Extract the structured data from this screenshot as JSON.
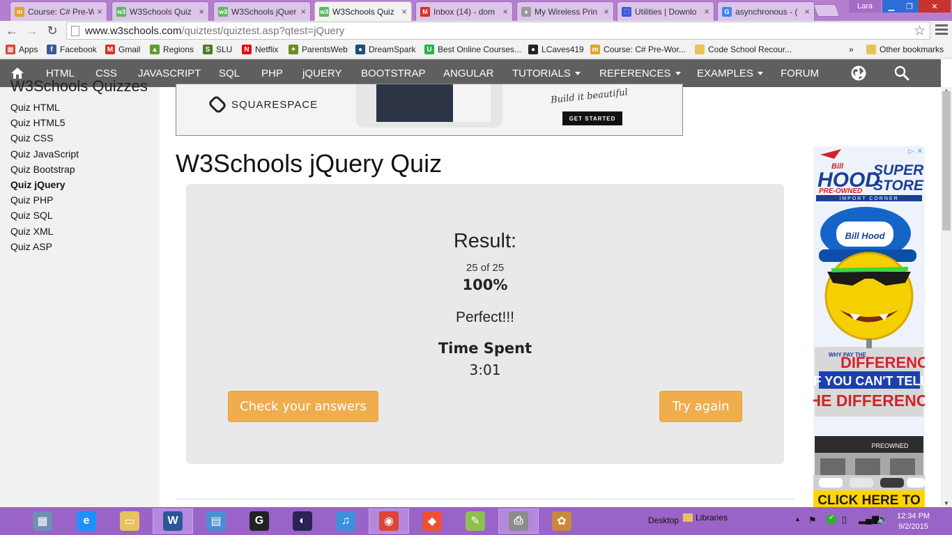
{
  "browser": {
    "tabs": [
      {
        "title": "Course: C# Pre-W",
        "icon": "moodle-hat-icon",
        "color": "#e2a32b",
        "glyph": "m",
        "active": false
      },
      {
        "title": "W3Schools Quiz",
        "icon": "w3schools-icon",
        "color": "#5cb85c",
        "glyph": "w3",
        "active": false
      },
      {
        "title": "W3Schools jQuer",
        "icon": "w3schools-icon",
        "color": "#5cb85c",
        "glyph": "w3",
        "active": false
      },
      {
        "title": "W3Schools Quiz",
        "icon": "w3schools-icon",
        "color": "#5cb85c",
        "glyph": "w3",
        "active": true
      },
      {
        "title": "Inbox (14) - dom",
        "icon": "gmail-icon",
        "color": "#d93025",
        "glyph": "M",
        "active": false
      },
      {
        "title": "My Wireless Prin",
        "icon": "printer-icon",
        "color": "#999999",
        "glyph": "♦",
        "active": false
      },
      {
        "title": "Utilities | Downlo",
        "icon": "website-icon",
        "color": "#3b5bd9",
        "glyph": "⬚",
        "active": false
      },
      {
        "title": "asynchronous - (",
        "icon": "google-icon",
        "color": "#4285f4",
        "glyph": "G",
        "active": false
      }
    ],
    "user": "Lara",
    "url_host": "www.w3schools.com",
    "url_path": "/quiztest/quiztest.asp?qtest=jQuery",
    "bookmarks": [
      {
        "label": "Apps",
        "icon": "apps-grid-icon",
        "color": "#db4437",
        "glyph": "▦"
      },
      {
        "label": "Facebook",
        "icon": "facebook-icon",
        "color": "#3b5998",
        "glyph": "f"
      },
      {
        "label": "Gmail",
        "icon": "gmail-icon",
        "color": "#d93025",
        "glyph": "M"
      },
      {
        "label": "Regions",
        "icon": "regions-icon",
        "color": "#5a9e32",
        "glyph": "▲"
      },
      {
        "label": "SLU",
        "icon": "slu-icon",
        "color": "#4a7a2a",
        "glyph": "S"
      },
      {
        "label": "Netflix",
        "icon": "netflix-icon",
        "color": "#e50914",
        "glyph": "N"
      },
      {
        "label": "ParentsWeb",
        "icon": "parentsweb-icon",
        "color": "#6b8e23",
        "glyph": "✦"
      },
      {
        "label": "DreamSpark",
        "icon": "dreamspark-icon",
        "color": "#1e4e79",
        "glyph": "●"
      },
      {
        "label": "Best Online Courses...",
        "icon": "udemy-icon",
        "color": "#2bb24c",
        "glyph": "U"
      },
      {
        "label": "LCaves419",
        "icon": "github-icon",
        "color": "#222222",
        "glyph": "●"
      },
      {
        "label": "Course: C# Pre-Wor...",
        "icon": "moodle-hat-icon",
        "color": "#e2a32b",
        "glyph": "m"
      },
      {
        "label": "Code School Recour...",
        "icon": "folder-icon",
        "color": "#e8c25a",
        "glyph": ""
      }
    ],
    "bookmarks_overflow": "»",
    "other_bookmarks": "Other bookmarks"
  },
  "nav": {
    "items": [
      {
        "label": "HTML",
        "dropdown": false
      },
      {
        "label": "CSS",
        "dropdown": false
      },
      {
        "label": "JAVASCRIPT",
        "dropdown": false
      },
      {
        "label": "SQL",
        "dropdown": false
      },
      {
        "label": "PHP",
        "dropdown": false
      },
      {
        "label": "jQUERY",
        "dropdown": false
      },
      {
        "label": "BOOTSTRAP",
        "dropdown": false
      },
      {
        "label": "ANGULAR",
        "dropdown": false
      },
      {
        "label": "TUTORIALS",
        "dropdown": true
      },
      {
        "label": "REFERENCES",
        "dropdown": true
      },
      {
        "label": "EXAMPLES",
        "dropdown": true
      },
      {
        "label": "FORUM",
        "dropdown": false
      }
    ]
  },
  "sidebar": {
    "heading": "W3Schools Quizzes",
    "links": [
      {
        "label": "Quiz HTML",
        "active": false
      },
      {
        "label": "Quiz HTML5",
        "active": false
      },
      {
        "label": "Quiz CSS",
        "active": false
      },
      {
        "label": "Quiz JavaScript",
        "active": false
      },
      {
        "label": "Quiz Bootstrap",
        "active": false
      },
      {
        "label": "Quiz jQuery",
        "active": true
      },
      {
        "label": "Quiz PHP",
        "active": false
      },
      {
        "label": "Quiz SQL",
        "active": false
      },
      {
        "label": "Quiz XML",
        "active": false
      },
      {
        "label": "Quiz ASP",
        "active": false
      }
    ]
  },
  "ad_banner": {
    "brand": "SQUARESPACE",
    "tagline": "Build it beautiful",
    "cta": "GET STARTED"
  },
  "main": {
    "title": "W3Schools jQuery Quiz",
    "result_label": "Result:",
    "score_count": "25 of 25",
    "score_percent": "100%",
    "message": "Perfect!!!",
    "time_label": "Time Spent",
    "time_value": "3:01",
    "check_button": "Check your answers",
    "again_button": "Try again"
  },
  "side_ad": {
    "brand_small": "Bill",
    "brand_big": "HOOD",
    "pre_owned": "PRE-OWNED",
    "super": "SUPER",
    "store": "STORE",
    "import_corner": "IMPORT CORNER",
    "cap_brand": "Bill Hood",
    "why_pay": "WHY PAY THE",
    "difference": "DIFFERENCE",
    "cant_tell": "IF YOU CAN'T TELL",
    "the_difference": "THE DIFFERENCE",
    "building_sign": "PREOWNED",
    "click": "CLICK HERE TO"
  },
  "taskbar": {
    "apps": [
      {
        "name": "calculator-icon",
        "color": "#6f8fb5",
        "glyph": "▦",
        "active": false
      },
      {
        "name": "internet-explorer-icon",
        "color": "#1e90ff",
        "glyph": "e",
        "active": false
      },
      {
        "name": "file-explorer-icon",
        "color": "#e8c25a",
        "glyph": "▭",
        "active": false
      },
      {
        "name": "word-icon",
        "color": "#2b579a",
        "glyph": "W",
        "active": true
      },
      {
        "name": "control-panel-icon",
        "color": "#4a8fd4",
        "glyph": "▤",
        "active": false
      },
      {
        "name": "gimp-g-icon",
        "color": "#222222",
        "glyph": "G",
        "active": false
      },
      {
        "name": "eclipse-icon",
        "color": "#2c2255",
        "glyph": "◐",
        "active": false
      },
      {
        "name": "itunes-icon",
        "color": "#3f8fdc",
        "glyph": "♫",
        "active": false
      },
      {
        "name": "chrome-icon",
        "color": "#db4437",
        "glyph": "◉",
        "active": true
      },
      {
        "name": "git-icon",
        "color": "#f05033",
        "glyph": "◆",
        "active": false
      },
      {
        "name": "notepad-plus-icon",
        "color": "#8fbf4f",
        "glyph": "✎",
        "active": false
      },
      {
        "name": "printer-fax-icon",
        "color": "#8c8c8c",
        "glyph": "⎙",
        "active": true
      },
      {
        "name": "paint-icon",
        "color": "#c98a3a",
        "glyph": "✿",
        "active": false
      }
    ],
    "desktop": "Desktop",
    "libraries": "Libraries",
    "time": "12:34 PM",
    "date": "9/2/2015"
  }
}
